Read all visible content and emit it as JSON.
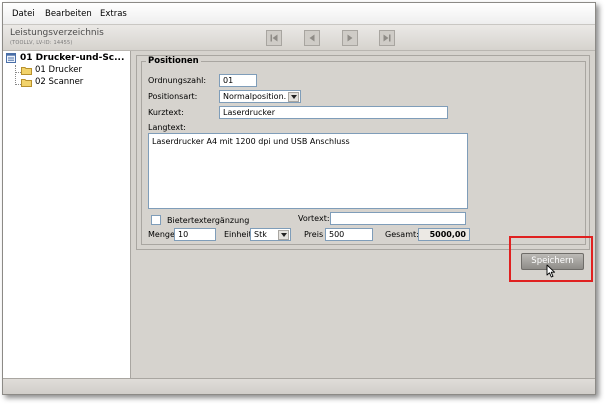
{
  "menu": {
    "items": [
      "Datei",
      "Bearbeiten",
      "Extras"
    ]
  },
  "header": {
    "title": "Leistungsverzeichnis",
    "subtitle": "(TOOLLV, LV-ID: 14455)"
  },
  "tree": {
    "root": "01 Drucker-und-Sc...",
    "children": [
      "01 Drucker",
      "02 Scanner"
    ]
  },
  "form": {
    "legend": "Positionen",
    "ordnungszahl_label": "Ordnungszahl:",
    "ordnungszahl_value": "01",
    "positionsart_label": "Positionsart:",
    "positionsart_value": "Normalposition.",
    "kurztext_label": "Kurztext:",
    "kurztext_value": "Laserdrucker",
    "langtext_label": "Langtext:",
    "langtext_value": "Laserdrucker A4 mit 1200 dpi und USB Anschluss",
    "bietertext_label": "Bietertextergänzung",
    "vortext_label": "Vortext:",
    "vortext_value": "",
    "menge_label": "Menge",
    "menge_value": "10",
    "einheit_label": "Einheit",
    "einheit_value": "Stk",
    "preis_label": "Preis",
    "preis_value": "500",
    "gesamt_label": "Gesamt:",
    "gesamt_value": "5000,00"
  },
  "actions": {
    "save_label": "Speichern"
  },
  "icons": {
    "nav": [
      "first-icon",
      "previous-icon",
      "next-icon",
      "last-icon"
    ],
    "tree_root": "list-icon",
    "tree_child": "folder-icon"
  },
  "colors": {
    "highlight": "#e02020",
    "folder": "#f2d36b"
  }
}
